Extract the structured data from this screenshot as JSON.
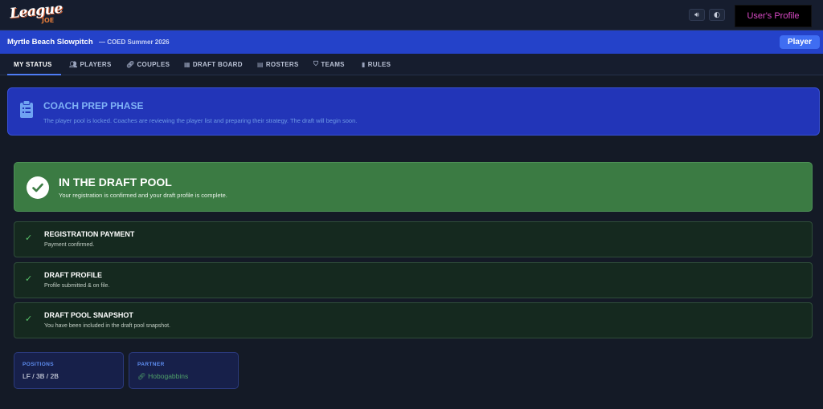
{
  "header": {
    "logo_text": "League",
    "logo_subtext": "JOE",
    "sound_icon": "speaker-icon",
    "theme_icon": "contrast-icon",
    "profile_label": "User's Profile"
  },
  "league_bar": {
    "name": "Myrtle Beach Slowpitch",
    "season": "— COED Summer 2026",
    "role_label": "Player"
  },
  "nav": {
    "tabs": [
      {
        "label": "MY STATUS",
        "icon": "",
        "active": true
      },
      {
        "label": "PLAYERS",
        "icon": "users-icon"
      },
      {
        "label": "COUPLES",
        "icon": "link-icon"
      },
      {
        "label": "DRAFT BOARD",
        "icon": "table-icon"
      },
      {
        "label": "ROSTERS",
        "icon": "clipboard-icon"
      },
      {
        "label": "TEAMS",
        "icon": "shield-icon"
      },
      {
        "label": "RULES",
        "icon": "book-icon"
      }
    ]
  },
  "phase": {
    "icon": "clipboard-icon",
    "title": "COACH PREP PHASE",
    "description": "The player pool is locked. Coaches are reviewing the player list and preparing their strategy. The draft will begin soon."
  },
  "pool_status": {
    "icon": "check-circle-icon",
    "title": "IN THE DRAFT POOL",
    "description": "Your registration is confirmed and your draft profile is complete."
  },
  "steps": [
    {
      "title": "REGISTRATION PAYMENT",
      "description": "Payment confirmed."
    },
    {
      "title": "DRAFT PROFILE",
      "description": "Profile submitted & on file."
    },
    {
      "title": "DRAFT POOL SNAPSHOT",
      "description": "You have been included in the draft pool snapshot."
    }
  ],
  "info": {
    "positions_label": "POSITIONS",
    "positions_value": "LF / 3B / 2B",
    "partner_label": "PARTNER",
    "partner_value": "Hobogabbins"
  },
  "colors": {
    "background": "#141a26",
    "league_bar": "#2442c9",
    "phase_card": "#2235b8",
    "success_card": "#3b7b43",
    "success_check": "#59c46b",
    "profile_text": "#d94ac6"
  }
}
